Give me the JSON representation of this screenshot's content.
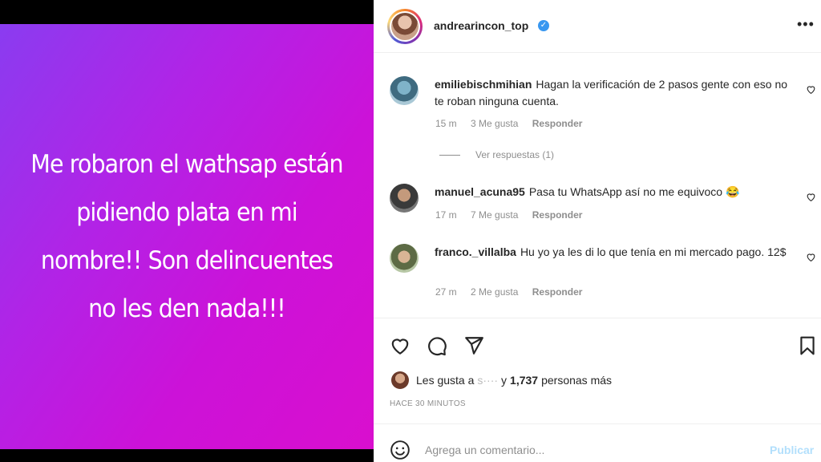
{
  "post": {
    "text": "Me robaron el wathsap están pidiendo plata en mi nombre!! Son delincuentes no les den nada!!!"
  },
  "header": {
    "username": "andrearincon_top",
    "verified_icon": "verified-badge-icon",
    "more_label": "•••"
  },
  "comments": [
    {
      "username": "emiliebischmihian",
      "text": "Hagan la verificación de 2 pasos gente con eso no te roban ninguna cuenta.",
      "time": "15 m",
      "likes": "3 Me gusta",
      "reply": "Responder"
    },
    {
      "username": "manuel_acuna95",
      "text": "Pasa tu WhatsApp así no me equivoco 😂",
      "time": "17 m",
      "likes": "7 Me gusta",
      "reply": "Responder"
    },
    {
      "username": "franco._villalba",
      "text": "Hu yo ya les di lo que tenía en mi mercado pago. 12$",
      "time": "27 m",
      "likes": "2 Me gusta",
      "reply": "Responder"
    }
  ],
  "view_replies": "Ver respuestas (1)",
  "likes": {
    "prefix": "Les gusta a",
    "blurred": "s····",
    "connector": "y",
    "count": "1,737",
    "suffix": "personas más"
  },
  "timestamp": "HACE 30 MINUTOS",
  "add_comment": {
    "placeholder": "Agrega un comentario...",
    "publish": "Publicar"
  },
  "colors": {
    "accent": "#3897f0",
    "gradient_start": "#8a3cf0",
    "gradient_end": "#d90fce"
  }
}
